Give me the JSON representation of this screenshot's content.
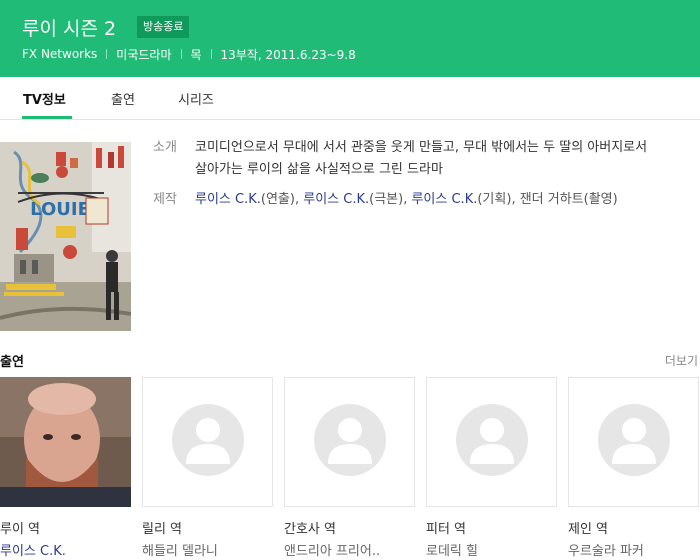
{
  "header": {
    "title": "루이 시즌 2",
    "badge": "방송종료",
    "network": "FX Networks",
    "genre": "미국드라마",
    "day": "목",
    "episodes_dates": "13부작, 2011.6.23~9.8",
    "background_color": "#20bb76"
  },
  "tabs": [
    {
      "label": "TV정보",
      "active": true
    },
    {
      "label": "출연",
      "active": false
    },
    {
      "label": "시리즈",
      "active": false
    }
  ],
  "poster": {
    "lettering": "LOUIE"
  },
  "intro": {
    "label": "소개",
    "text": "코미디언으로서 무대에 서서 관중을 웃게 만들고, 무대 밖에서는 두 딸의 아버지로서 살아가는 루이의 삶을 사실적으로 그린 드라마"
  },
  "production": {
    "label": "제작",
    "credits": [
      {
        "name": "루이스 C.K.",
        "role": "(연출)",
        "sep": ", "
      },
      {
        "name": "루이스 C.K.",
        "role": "(극본)",
        "sep": ", "
      },
      {
        "name": "루이스 C.K.",
        "role": "(기획)",
        "sep": ", "
      },
      {
        "name": "잰더 거하트",
        "role": "(촬영)",
        "sep": ""
      }
    ]
  },
  "cast_section": {
    "title": "출연",
    "more": "더보기",
    "members": [
      {
        "role": "루이 역",
        "actor": "루이스 C.K.",
        "has_photo": true
      },
      {
        "role": "릴리 역",
        "actor": "해들리 델라니",
        "has_photo": false
      },
      {
        "role": "간호사 역",
        "actor": "앤드리아 프리어..",
        "has_photo": false
      },
      {
        "role": "피터 역",
        "actor": "로데릭 힐",
        "has_photo": false
      },
      {
        "role": "제인 역",
        "actor": "우르술라 파커",
        "has_photo": false
      }
    ]
  }
}
